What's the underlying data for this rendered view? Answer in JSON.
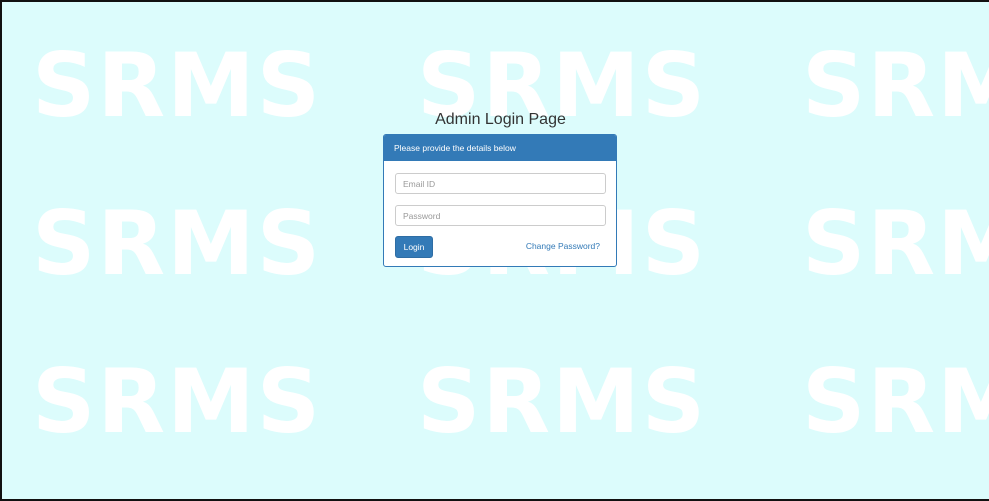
{
  "watermark": {
    "text": "SRMS"
  },
  "page": {
    "title": "Admin Login Page"
  },
  "login_panel": {
    "heading": "Please provide the details below",
    "email_placeholder": "Email ID",
    "password_placeholder": "Password",
    "login_label": "Login",
    "change_password_label": "Change Password?"
  },
  "colors": {
    "background": "#dcfcfc",
    "primary": "#337ab7",
    "watermark": "#ffffff"
  }
}
